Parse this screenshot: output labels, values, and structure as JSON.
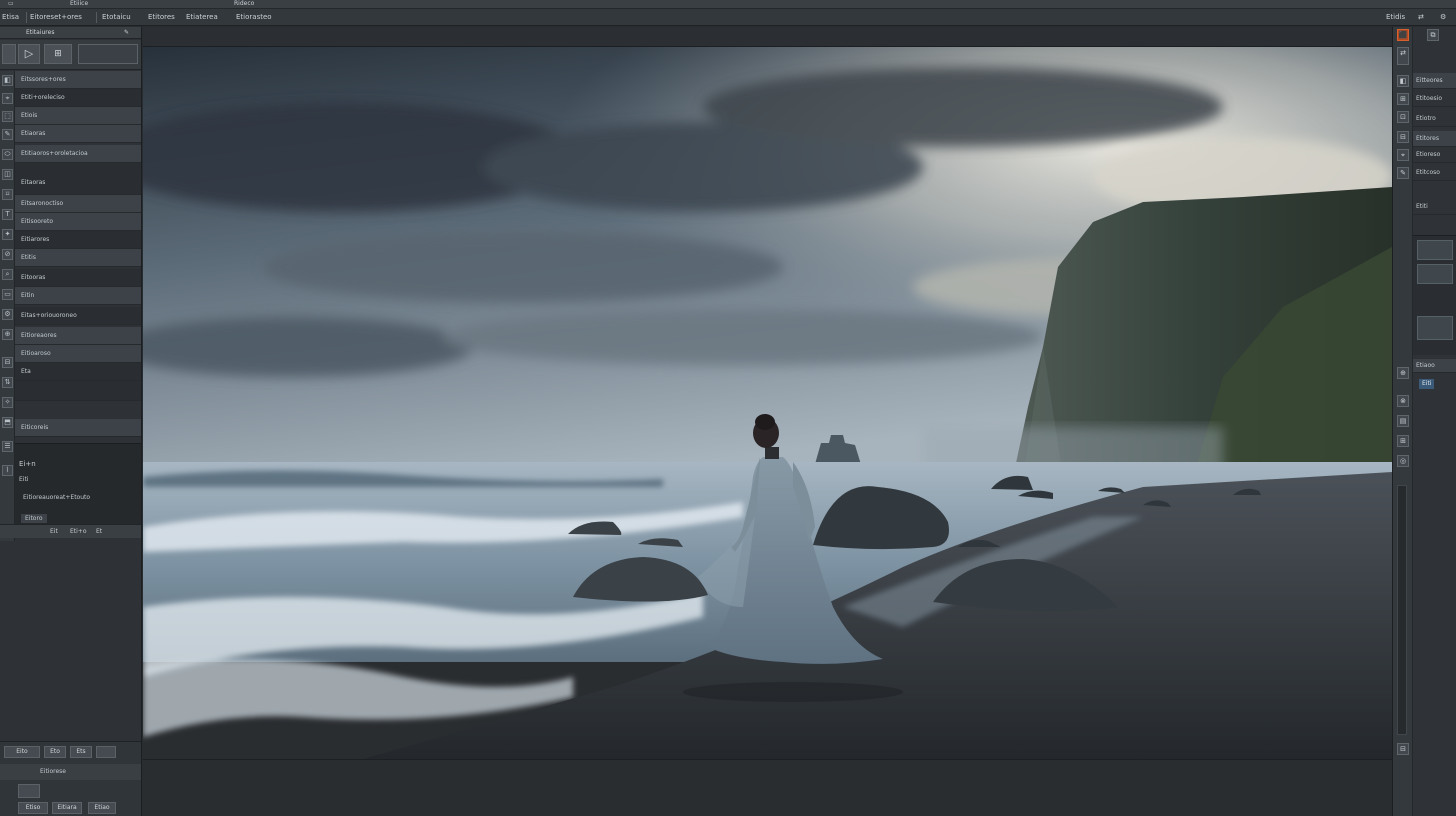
{
  "menubar": {
    "items": [
      "▭",
      "Etiiice",
      "Rideco"
    ]
  },
  "options_bar": {
    "items": [
      "Etisa",
      "Eitoreset+ores",
      "Etotaicu",
      "Etitores",
      "Etiaterea",
      "Etiorasteo"
    ],
    "right_items": [
      "Etidis",
      "⇄",
      "⚙"
    ]
  },
  "left_panel": {
    "header_label": "Etitaiures",
    "header_icons": [
      "✎",
      "⌂"
    ],
    "tool_glyphs": [
      "◧",
      "▷",
      "⊞",
      "⌖",
      "⬚",
      "✎",
      "⬭",
      "◫",
      "⌑",
      "T",
      "✦",
      "⊘",
      "⌕",
      "▭",
      "⚙",
      "⊕",
      "⊟",
      "⇅",
      "✧",
      "⬒",
      "☰",
      "⌇"
    ],
    "rows": [
      "Eitssores+ores",
      "Etiti+oreleciso",
      "Etiois",
      "Etiaoras",
      "Etitiaoros+oroletacioa",
      "Eitaoras",
      "Eitsaronoctiso",
      "Eitisooreto",
      "Eitiarores",
      "Etitis",
      "Eitooras",
      "Eitin",
      "Eitas+oriouoroneo",
      "Eitioreaores",
      "Eitioaroso",
      "Eta",
      "",
      "Eiticoreis"
    ],
    "preview_text_1": "Ei+n",
    "preview_text_2": "Eiti",
    "preview_text_3": "Eitioreauoreat+Etouto",
    "preview_badge": "Eitoro",
    "bottom_buttons_row1": [
      "Eito",
      "Eto",
      "Ets"
    ],
    "bottom_buttons_row2": [
      "Etiso",
      "Eitiara",
      "Etiao"
    ],
    "bottom_label": "Eitiorese",
    "bottom_small": [
      "Eit",
      "Eti+o",
      "Et"
    ]
  },
  "right_panel": {
    "top_buttons": [
      "⬛",
      "⧉"
    ],
    "rows": [
      "Eitteores",
      "Etitoesio",
      "Etiotro",
      "Etitores",
      "Etioreso",
      "Etitcoso",
      "Etiti"
    ],
    "icons": [
      "⇄",
      "◧",
      "⊞",
      "⊡",
      "⊟",
      "⌖",
      "✎",
      "⊕",
      "⊗",
      "▤",
      "⊞",
      "◎",
      "▭",
      "⊟"
    ],
    "layer_label": "Etiaoo",
    "layer_tag": "Eiti"
  },
  "canvas": {
    "sky_top": "#2b3540",
    "sky_glow": "#e9e6dc",
    "sea": "#8fa3b3",
    "sand": "#2c3035",
    "cliff": "#2f3a31",
    "dress": "#6f8394"
  }
}
